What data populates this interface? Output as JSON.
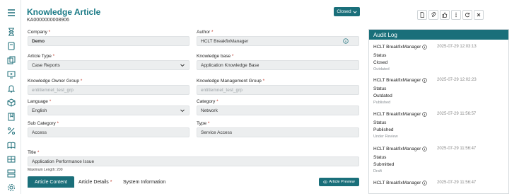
{
  "header": {
    "title": "Knowledge Article",
    "number": "KA0000000008906",
    "status": "Closed",
    "toolbar": [
      "pdf-icon",
      "attach-icon",
      "like-icon",
      "more-icon",
      "refresh-icon",
      "close-icon"
    ]
  },
  "rail_icons": [
    "menu-icon",
    "hourglass-icon",
    "book-icon",
    "copy-icon",
    "monitor-plus-icon",
    "bell-icon",
    "box-icon",
    "bookmark-icon",
    "percent-icon",
    "book-open-icon",
    "grid-icon",
    "layers-icon",
    "gear-icon"
  ],
  "form": {
    "company": {
      "label": "Company",
      "value": "Demo"
    },
    "author": {
      "label": "Author",
      "value": "HCLT BreakfixManager"
    },
    "article_type": {
      "label": "Article Type",
      "value": "Case Reports"
    },
    "knowledge_base": {
      "label": "Knowledge base",
      "value": "Application Knowledge Base"
    },
    "owner_group": {
      "label": "Knowledge Owner Group",
      "value": "entitlemnet_test_grp"
    },
    "management_group": {
      "label": "Knowledge Management Group",
      "value": "entitlemnet_test_grp"
    },
    "language": {
      "label": "Language",
      "value": "English"
    },
    "category": {
      "label": "Category",
      "value": "Network"
    },
    "sub_category": {
      "label": "Sub Category",
      "value": "Access"
    },
    "type": {
      "label": "Type",
      "value": "Service Access"
    },
    "title": {
      "label": "Title",
      "value": "Application Performance Issue",
      "helper": "Maximum Length: 200"
    }
  },
  "tabs": {
    "content": "Article Content",
    "details": "Article Details",
    "system": "System Information",
    "preview": "Article Preview"
  },
  "audit": {
    "title": "Audit Log",
    "entries": [
      {
        "user": "HCLT BreakfixManager",
        "time": "2025-07-29 12:03:13",
        "field": "Status",
        "new": "Closed",
        "old": "Outdated"
      },
      {
        "user": "HCLT BreakfixManager",
        "time": "2025-07-29 12:02:23",
        "field": "Status",
        "new": "Outdated",
        "old": "Published"
      },
      {
        "user": "HCLT BreakfixManager",
        "time": "2025-07-29 11:56:57",
        "field": "Status",
        "new": "Published",
        "old": "Under Review"
      },
      {
        "user": "HCLT BreakfixManager",
        "time": "2025-07-29 11:56:47",
        "field": "Status",
        "new": "Submitted",
        "old": "Draft"
      },
      {
        "user": "HCLT BreakfixManager",
        "time": "2025-07-29 11:56:47",
        "field": "",
        "new": "",
        "old": ""
      }
    ]
  },
  "colors": {
    "accent": "#1a6f7a",
    "title": "#1a7a86",
    "required": "#c0392b",
    "field_bg": "#eceeef"
  }
}
